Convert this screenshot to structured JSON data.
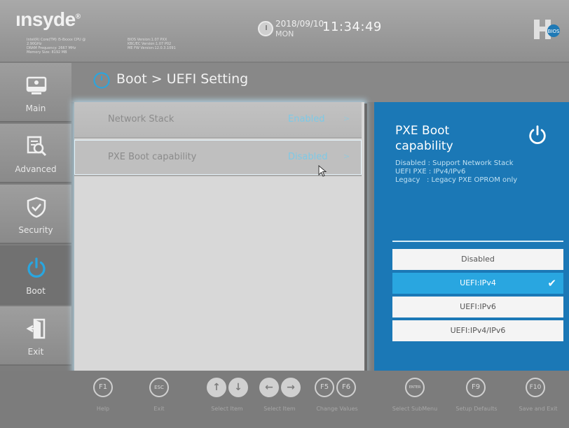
{
  "header": {
    "brand": "ınsyde",
    "brand_mark": "®",
    "sysinfo_left": [
      "Intel(R) Core(TM) i5-8xxxx CPU @",
      "2.90GHz",
      "DRAM Frequency: 2667 MHz",
      "Memory Size: 8192 MB"
    ],
    "sysinfo_right": [
      "BIOS Version:1.07 PXX",
      "KBC/EC Version:1.07 P02",
      "ME FW Version:12.0.3.1091"
    ],
    "date": "2018/09/10",
    "day": "MON",
    "time": "11:34:49",
    "logo_text": "insyde H2 BIOS"
  },
  "sidebar": {
    "items": [
      {
        "label": "Main",
        "icon": "monitor-icon"
      },
      {
        "label": "Advanced",
        "icon": "magnifier-icon"
      },
      {
        "label": "Security",
        "icon": "shield-icon"
      },
      {
        "label": "Boot",
        "icon": "power-icon",
        "active": true
      },
      {
        "label": "Exit",
        "icon": "exit-door-icon"
      }
    ]
  },
  "title": {
    "text": "Boot > UEFI Setting",
    "icon": "power-icon"
  },
  "settings": [
    {
      "name": "Network Stack",
      "value": "Enabled",
      "chevron": ">"
    },
    {
      "name": "PXE Boot capability",
      "value": "Disabled",
      "chevron": ">"
    }
  ],
  "help": {
    "title": "PXE Boot capability",
    "description": "Disabled : Support Network Stack\nUEFI PXE : IPv4/IPv6\nLegacy   : Legacy PXE OPROM only",
    "options": [
      {
        "label": "Disabled",
        "selected": false
      },
      {
        "label": "UEFI:IPv4",
        "selected": true
      },
      {
        "label": "UEFI:IPv6",
        "selected": false
      },
      {
        "label": "UEFI:IPv4/IPv6",
        "selected": false
      }
    ],
    "check_glyph": "✔"
  },
  "footer": {
    "keys": [
      {
        "key": "F1",
        "label": "Help"
      },
      {
        "key": "ESC",
        "label": "Exit"
      },
      {
        "key": "↑↓",
        "label": "Select Item"
      },
      {
        "key": "←→",
        "label": "Select Item"
      },
      {
        "key": "F5 F6",
        "label": "Change Values"
      },
      {
        "key": "ENTER",
        "label": "Select SubMenu"
      },
      {
        "key": "F9",
        "label": "Setup Defaults"
      },
      {
        "key": "F10",
        "label": "Save and Exit"
      }
    ]
  },
  "colors": {
    "accent": "#29a6e0",
    "help_panel": "#1b78b6",
    "value_text": "#7dc9e6"
  }
}
